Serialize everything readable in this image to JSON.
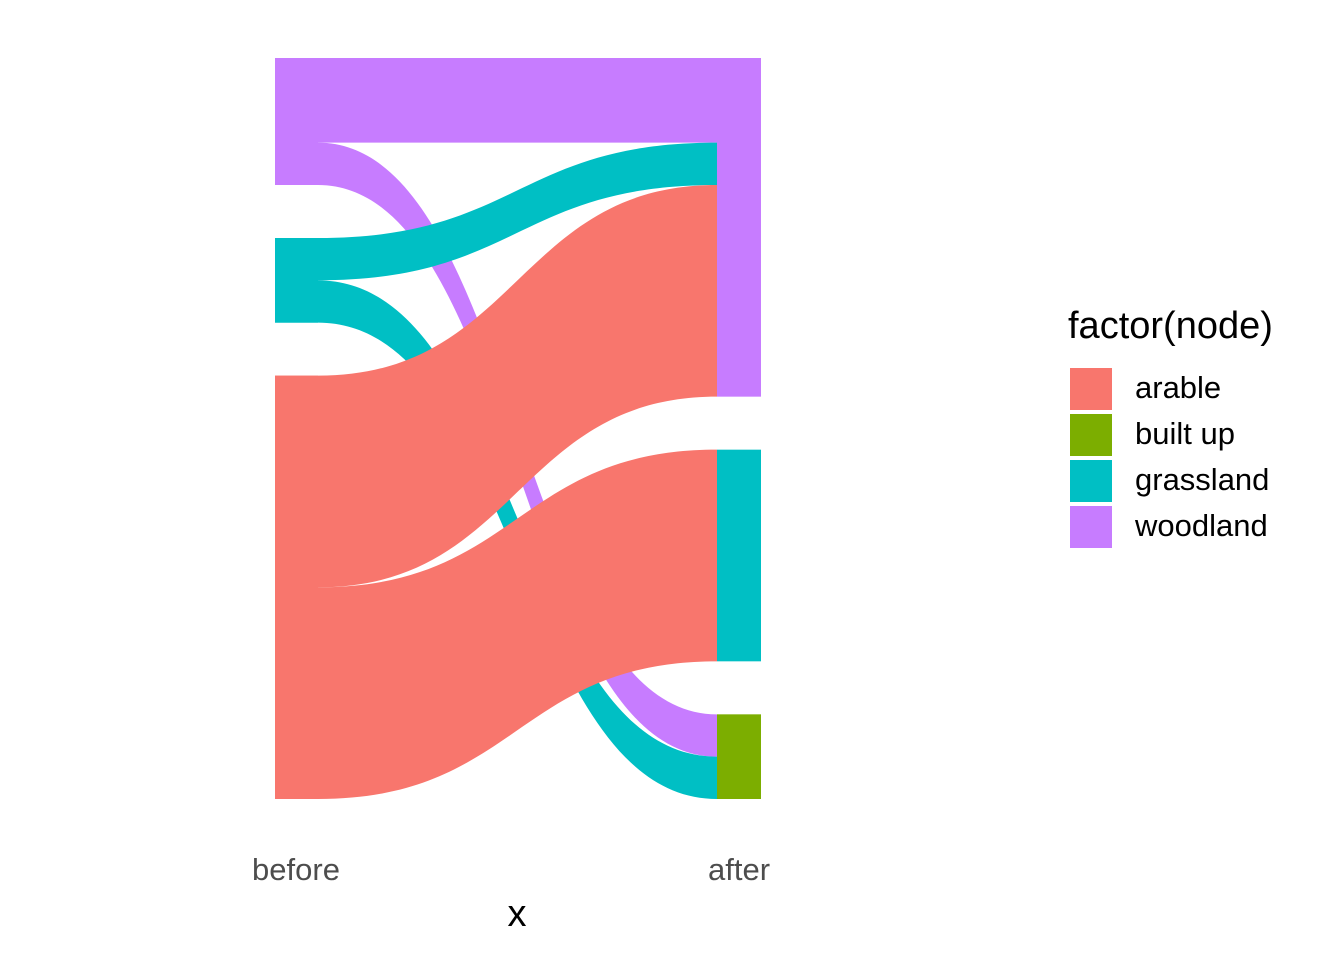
{
  "chart_data": {
    "type": "sankey",
    "axes": [
      "before",
      "after"
    ],
    "xlabel": "x",
    "legend_title": "factor(node)",
    "legend_position": "right",
    "categories": [
      "arable",
      "built up",
      "grassland",
      "woodland"
    ],
    "colors": {
      "arable": "#F8766D",
      "built up": "#7CAE00",
      "grassland": "#00BFC4",
      "woodland": "#C77CFF"
    },
    "nodes_before": [
      "woodland",
      "grassland",
      "arable"
    ],
    "nodes_after": [
      "woodland",
      "grassland",
      "built up"
    ],
    "flows": [
      {
        "from": "woodland",
        "to": "woodland",
        "value": 2
      },
      {
        "from": "woodland",
        "to": "built up",
        "value": 1
      },
      {
        "from": "grassland",
        "to": "woodland",
        "value": 1
      },
      {
        "from": "grassland",
        "to": "built up",
        "value": 1
      },
      {
        "from": "arable",
        "to": "woodland",
        "value": 5
      },
      {
        "from": "arable",
        "to": "grassland",
        "value": 5
      }
    ]
  }
}
